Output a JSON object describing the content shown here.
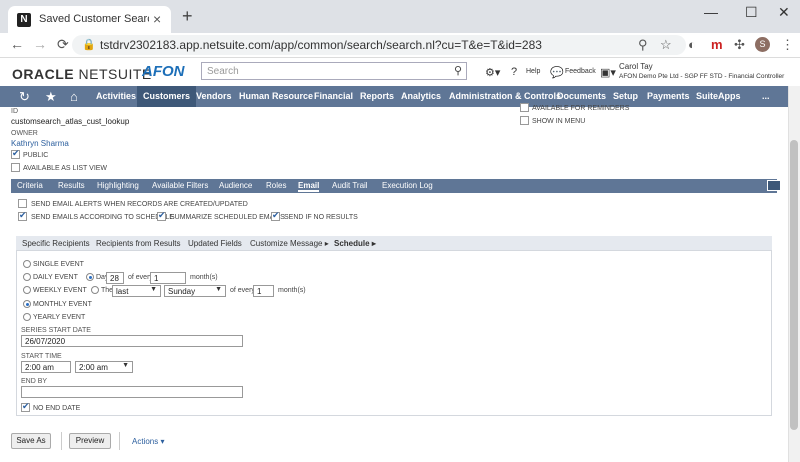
{
  "browser": {
    "tab_title": "Saved Customer Search - NetSuite",
    "favicon_letter": "N",
    "url": "tstdrv2302183.app.netsuite.com/app/common/search/search.nl?cu=T&e=T&id=283",
    "profile_initial": "S",
    "ext_letter": "m"
  },
  "header": {
    "logo_oracle": "ORACLE",
    "logo_netsuite": "NETSUITE",
    "brand": "AFON",
    "search_placeholder": "Search",
    "help": "Help",
    "feedback": "Feedback",
    "user_name": "Carol Tay",
    "user_detail": "AFON Demo Pte Ltd - SGP FF STD - Financial Controller"
  },
  "nav": {
    "items": [
      "Activities",
      "Customers",
      "Vendors",
      "Human Resource",
      "Financial",
      "Reports",
      "Analytics",
      "Administration & Controls",
      "Documents",
      "Setup",
      "Payments",
      "SuiteApps",
      "..."
    ]
  },
  "form": {
    "id_label": "ID",
    "id_value": "customsearch_atlas_cust_lookup",
    "owner_label": "OWNER",
    "owner_value": "Kathryn Sharma",
    "public_label": "PUBLIC",
    "available_list_label": "AVAILABLE AS LIST VIEW",
    "available_reminders_label": "AVAILABLE FOR REMINDERS",
    "show_menu_label": "SHOW IN MENU"
  },
  "subtabs": [
    "Criteria",
    "Results",
    "Highlighting",
    "Available Filters",
    "Audience",
    "Roles",
    "Email",
    "Audit Trail",
    "Execution Log"
  ],
  "email": {
    "send_alerts": "SEND EMAIL ALERTS WHEN RECORDS ARE CREATED/UPDATED",
    "send_schedule": "SEND EMAILS ACCORDING TO SCHEDULE",
    "summarize": "SUMMARIZE SCHEDULED EMAILS",
    "send_no_results": "SEND IF NO RESULTS"
  },
  "inner_tabs": [
    "Specific Recipients",
    "Recipients from Results",
    "Updated Fields",
    "Customize Message",
    "Schedule"
  ],
  "schedule": {
    "single": "SINGLE EVENT",
    "daily": "DAILY EVENT",
    "weekly": "WEEKLY EVENT",
    "monthly": "MONTHLY EVENT",
    "yearly": "YEARLY EVENT",
    "day_label": "Day",
    "day_value": "28",
    "of_every": "of every",
    "every_value": "1",
    "months_label": "month(s)",
    "the_label": "The",
    "the_value": "last",
    "weekday_value": "Sunday",
    "of_every2": "of every",
    "every_value2": "1",
    "months_label2": "month(s)",
    "series_start_label": "SERIES START DATE",
    "series_start_value": "26/07/2020",
    "start_time_label": "START TIME",
    "start_time_value": "2:00 am",
    "start_time_select": "2:00 am",
    "end_by_label": "END BY",
    "end_by_value": "",
    "no_end_date": "NO END DATE"
  },
  "buttons": {
    "save_as": "Save As",
    "preview": "Preview",
    "actions": "Actions"
  }
}
